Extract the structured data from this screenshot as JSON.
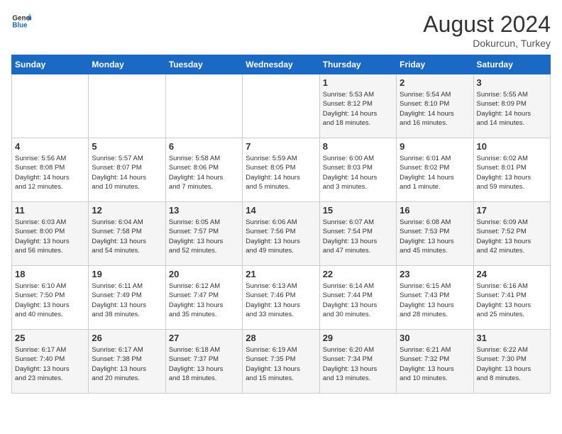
{
  "header": {
    "logo_general": "General",
    "logo_blue": "Blue",
    "month_year": "August 2024",
    "location": "Dokurcun, Turkey"
  },
  "weekdays": [
    "Sunday",
    "Monday",
    "Tuesday",
    "Wednesday",
    "Thursday",
    "Friday",
    "Saturday"
  ],
  "weeks": [
    [
      {
        "day": "",
        "info": ""
      },
      {
        "day": "",
        "info": ""
      },
      {
        "day": "",
        "info": ""
      },
      {
        "day": "",
        "info": ""
      },
      {
        "day": "1",
        "info": "Sunrise: 5:53 AM\nSunset: 8:12 PM\nDaylight: 14 hours\nand 18 minutes."
      },
      {
        "day": "2",
        "info": "Sunrise: 5:54 AM\nSunset: 8:10 PM\nDaylight: 14 hours\nand 16 minutes."
      },
      {
        "day": "3",
        "info": "Sunrise: 5:55 AM\nSunset: 8:09 PM\nDaylight: 14 hours\nand 14 minutes."
      }
    ],
    [
      {
        "day": "4",
        "info": "Sunrise: 5:56 AM\nSunset: 8:08 PM\nDaylight: 14 hours\nand 12 minutes."
      },
      {
        "day": "5",
        "info": "Sunrise: 5:57 AM\nSunset: 8:07 PM\nDaylight: 14 hours\nand 10 minutes."
      },
      {
        "day": "6",
        "info": "Sunrise: 5:58 AM\nSunset: 8:06 PM\nDaylight: 14 hours\nand 7 minutes."
      },
      {
        "day": "7",
        "info": "Sunrise: 5:59 AM\nSunset: 8:05 PM\nDaylight: 14 hours\nand 5 minutes."
      },
      {
        "day": "8",
        "info": "Sunrise: 6:00 AM\nSunset: 8:03 PM\nDaylight: 14 hours\nand 3 minutes."
      },
      {
        "day": "9",
        "info": "Sunrise: 6:01 AM\nSunset: 8:02 PM\nDaylight: 14 hours\nand 1 minute."
      },
      {
        "day": "10",
        "info": "Sunrise: 6:02 AM\nSunset: 8:01 PM\nDaylight: 13 hours\nand 59 minutes."
      }
    ],
    [
      {
        "day": "11",
        "info": "Sunrise: 6:03 AM\nSunset: 8:00 PM\nDaylight: 13 hours\nand 56 minutes."
      },
      {
        "day": "12",
        "info": "Sunrise: 6:04 AM\nSunset: 7:58 PM\nDaylight: 13 hours\nand 54 minutes."
      },
      {
        "day": "13",
        "info": "Sunrise: 6:05 AM\nSunset: 7:57 PM\nDaylight: 13 hours\nand 52 minutes."
      },
      {
        "day": "14",
        "info": "Sunrise: 6:06 AM\nSunset: 7:56 PM\nDaylight: 13 hours\nand 49 minutes."
      },
      {
        "day": "15",
        "info": "Sunrise: 6:07 AM\nSunset: 7:54 PM\nDaylight: 13 hours\nand 47 minutes."
      },
      {
        "day": "16",
        "info": "Sunrise: 6:08 AM\nSunset: 7:53 PM\nDaylight: 13 hours\nand 45 minutes."
      },
      {
        "day": "17",
        "info": "Sunrise: 6:09 AM\nSunset: 7:52 PM\nDaylight: 13 hours\nand 42 minutes."
      }
    ],
    [
      {
        "day": "18",
        "info": "Sunrise: 6:10 AM\nSunset: 7:50 PM\nDaylight: 13 hours\nand 40 minutes."
      },
      {
        "day": "19",
        "info": "Sunrise: 6:11 AM\nSunset: 7:49 PM\nDaylight: 13 hours\nand 38 minutes."
      },
      {
        "day": "20",
        "info": "Sunrise: 6:12 AM\nSunset: 7:47 PM\nDaylight: 13 hours\nand 35 minutes."
      },
      {
        "day": "21",
        "info": "Sunrise: 6:13 AM\nSunset: 7:46 PM\nDaylight: 13 hours\nand 33 minutes."
      },
      {
        "day": "22",
        "info": "Sunrise: 6:14 AM\nSunset: 7:44 PM\nDaylight: 13 hours\nand 30 minutes."
      },
      {
        "day": "23",
        "info": "Sunrise: 6:15 AM\nSunset: 7:43 PM\nDaylight: 13 hours\nand 28 minutes."
      },
      {
        "day": "24",
        "info": "Sunrise: 6:16 AM\nSunset: 7:41 PM\nDaylight: 13 hours\nand 25 minutes."
      }
    ],
    [
      {
        "day": "25",
        "info": "Sunrise: 6:17 AM\nSunset: 7:40 PM\nDaylight: 13 hours\nand 23 minutes."
      },
      {
        "day": "26",
        "info": "Sunrise: 6:17 AM\nSunset: 7:38 PM\nDaylight: 13 hours\nand 20 minutes."
      },
      {
        "day": "27",
        "info": "Sunrise: 6:18 AM\nSunset: 7:37 PM\nDaylight: 13 hours\nand 18 minutes."
      },
      {
        "day": "28",
        "info": "Sunrise: 6:19 AM\nSunset: 7:35 PM\nDaylight: 13 hours\nand 15 minutes."
      },
      {
        "day": "29",
        "info": "Sunrise: 6:20 AM\nSunset: 7:34 PM\nDaylight: 13 hours\nand 13 minutes."
      },
      {
        "day": "30",
        "info": "Sunrise: 6:21 AM\nSunset: 7:32 PM\nDaylight: 13 hours\nand 10 minutes."
      },
      {
        "day": "31",
        "info": "Sunrise: 6:22 AM\nSunset: 7:30 PM\nDaylight: 13 hours\nand 8 minutes."
      }
    ]
  ]
}
